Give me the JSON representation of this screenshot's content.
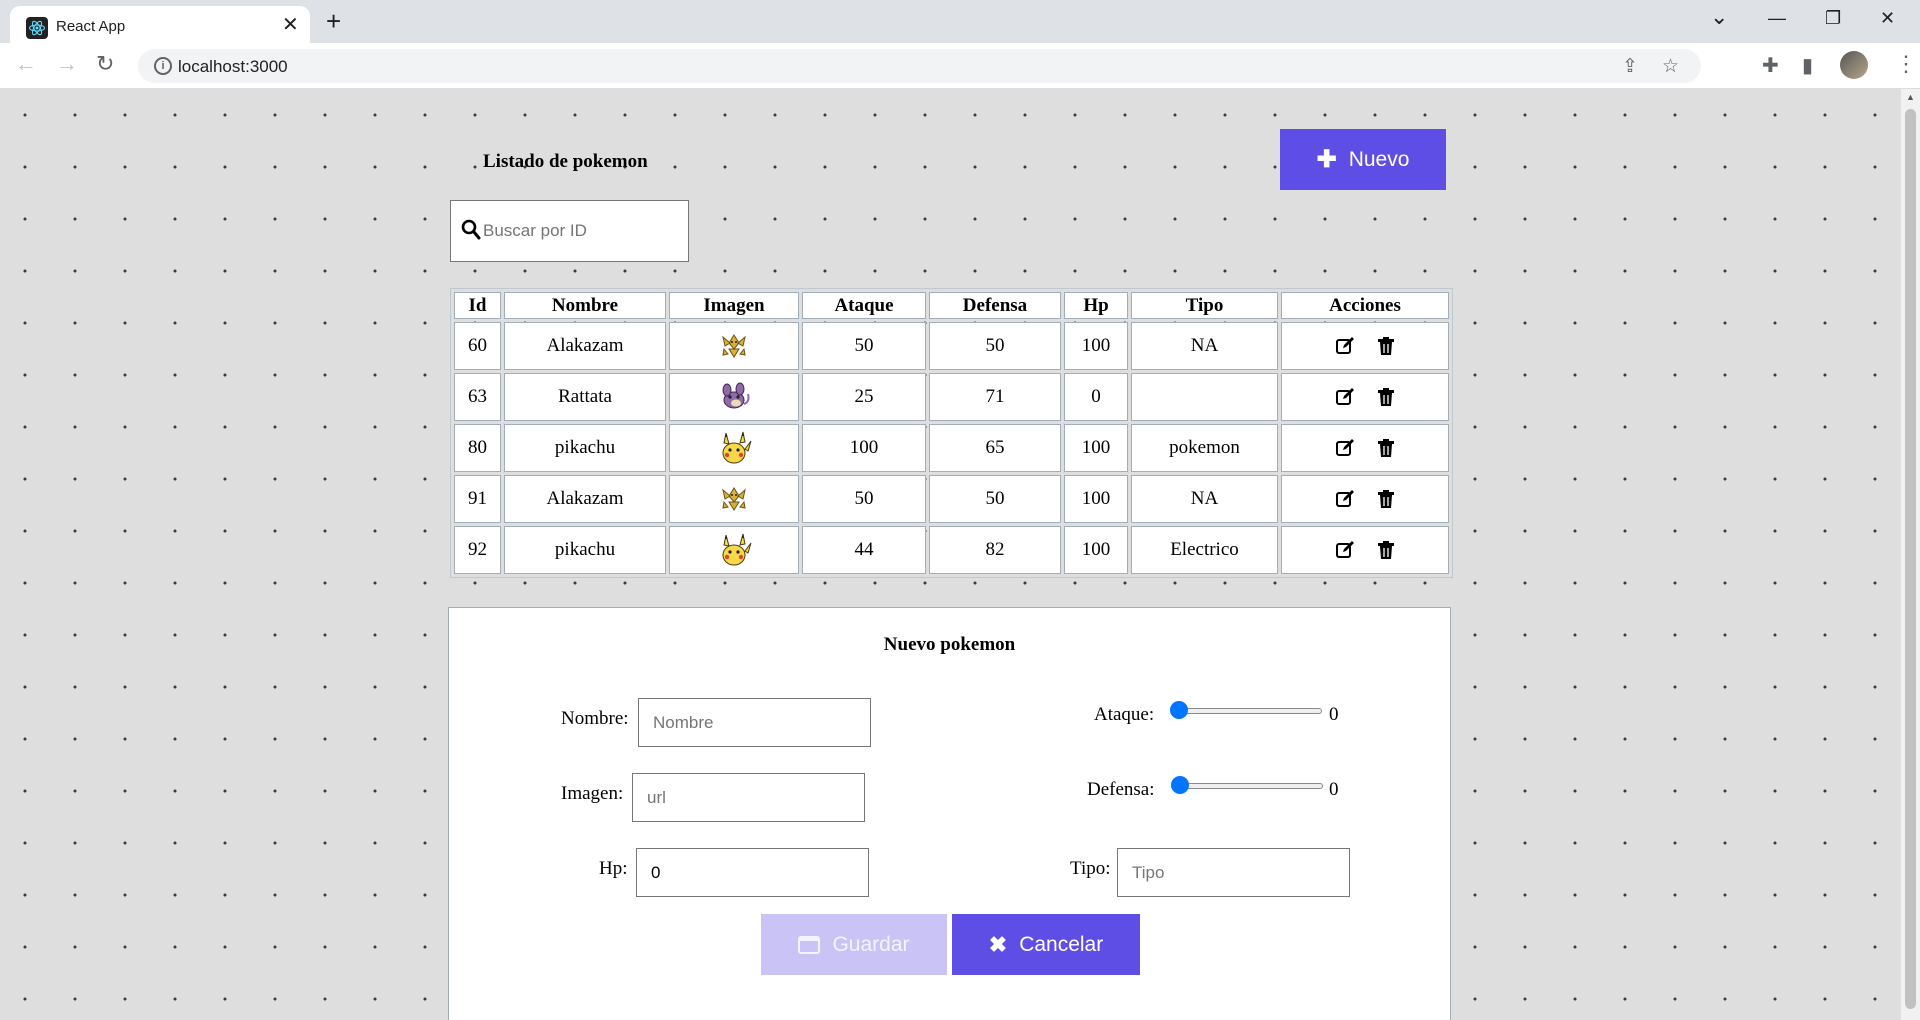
{
  "browser": {
    "tab_title": "React App",
    "tab_close": "✕",
    "new_tab": "+",
    "url": "localhost:3000",
    "window_controls": {
      "collapse": "⌄",
      "minimize": "—",
      "restore": "❐",
      "close": "✕"
    },
    "nav": {
      "back": "←",
      "forward": "→",
      "reload": "↻"
    }
  },
  "page": {
    "list_title": "Listado de pokemon",
    "new_button_label": "Nuevo",
    "search": {
      "placeholder": "Buscar por ID"
    },
    "table": {
      "headers": [
        "Id",
        "Nombre",
        "Imagen",
        "Ataque",
        "Defensa",
        "Hp",
        "Tipo",
        "Acciones"
      ],
      "rows": [
        {
          "id": "60",
          "nombre": "Alakazam",
          "imagen": "alakazam-sprite",
          "ataque": "50",
          "defensa": "50",
          "hp": "100",
          "tipo": "NA"
        },
        {
          "id": "63",
          "nombre": "Rattata",
          "imagen": "rattata-sprite",
          "ataque": "25",
          "defensa": "71",
          "hp": "0",
          "tipo": ""
        },
        {
          "id": "80",
          "nombre": "pikachu",
          "imagen": "pikachu-sprite",
          "ataque": "100",
          "defensa": "65",
          "hp": "100",
          "tipo": "pokemon"
        },
        {
          "id": "91",
          "nombre": "Alakazam",
          "imagen": "alakazam-sprite",
          "ataque": "50",
          "defensa": "50",
          "hp": "100",
          "tipo": "NA"
        },
        {
          "id": "92",
          "nombre": "pikachu",
          "imagen": "pikachu-sprite",
          "ataque": "44",
          "defensa": "82",
          "hp": "100",
          "tipo": "Electrico"
        }
      ]
    },
    "form": {
      "title": "Nuevo pokemon",
      "nombre_label": "Nombre:",
      "nombre_placeholder": "Nombre",
      "imagen_label": "Imagen:",
      "imagen_placeholder": "url",
      "hp_label": "Hp:",
      "hp_value": "0",
      "ataque_label": "Ataque:",
      "ataque_value": "0",
      "defensa_label": "Defensa:",
      "defensa_value": "0",
      "tipo_label": "Tipo:",
      "tipo_placeholder": "Tipo",
      "save_label": "Guardar",
      "cancel_label": "Cancelar"
    }
  },
  "colors": {
    "accent": "#5f4ee6",
    "accent_disabled": "#c9c3f6",
    "slider": "#0075ff",
    "page_bg": "#dedede"
  }
}
